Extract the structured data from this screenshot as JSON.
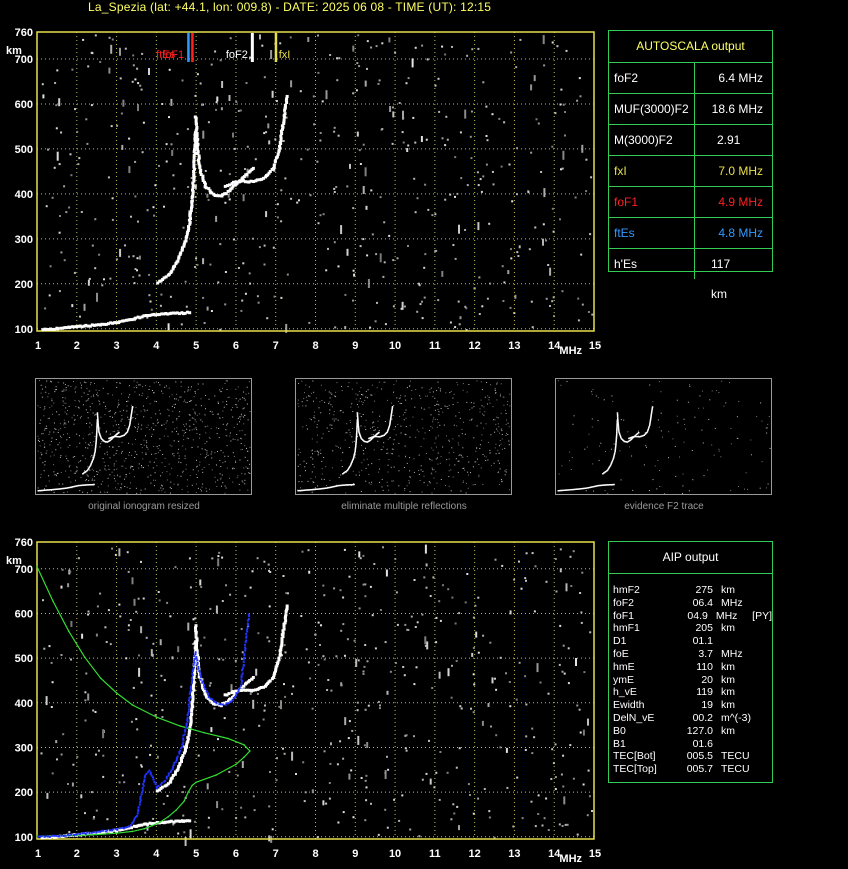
{
  "header": "La_Spezia (lat: +44.1, lon: 009.8) - DATE: 2025 06 08 - TIME (UT): 12:15",
  "colors": {
    "axis": "#e8e04a",
    "grid": "#bfbf40",
    "frame": "#33cc55",
    "trace": "#ffffff",
    "model": "#33dd33",
    "fit": "#2233ff",
    "foF1": "#ff2020",
    "ftEs": "#3399ff",
    "fxI": "#e8e04a"
  },
  "chart_data": [
    {
      "type": "scatter",
      "xlabel": "MHz",
      "ylabel": "km",
      "xlim": [
        1,
        15
      ],
      "ylim": [
        95,
        760
      ],
      "xticks": [
        "1",
        "2",
        "3",
        "4",
        "5",
        "6",
        "7",
        "8",
        "9",
        "10",
        "11",
        "12",
        "13",
        "14",
        "15"
      ],
      "yticks": [
        "100",
        "200",
        "300",
        "400",
        "500",
        "600",
        "700",
        "760"
      ],
      "markers": [
        {
          "label": "ftEs",
          "freq": 4.8
        },
        {
          "label": "foF1",
          "freq": 4.9
        },
        {
          "label": "foF2",
          "freq": 6.4
        },
        {
          "label": "fxI",
          "freq": 7.0
        }
      ],
      "series": [
        {
          "x": [
            1.1,
            1.5,
            2.0,
            2.5,
            3.0,
            3.4,
            3.7,
            4.0,
            4.3,
            4.6,
            4.8
          ],
          "y": [
            101,
            104,
            108,
            112,
            118,
            126,
            132,
            135,
            137,
            138,
            139
          ]
        },
        {
          "x": [
            4.0,
            4.3,
            4.5,
            4.7,
            4.8,
            4.85,
            4.9,
            4.95
          ],
          "y": [
            205,
            225,
            255,
            300,
            340,
            380,
            440,
            540
          ]
        },
        {
          "x": [
            4.95,
            5.0,
            5.05,
            5.2,
            5.4,
            5.6,
            5.8,
            6.0,
            6.2,
            6.4
          ],
          "y": [
            575,
            510,
            460,
            420,
            402,
            398,
            410,
            428,
            445,
            460
          ]
        },
        {
          "x": [
            5.7,
            5.9,
            6.1,
            6.4,
            6.7,
            6.9,
            7.05,
            7.15,
            7.25
          ],
          "y": [
            420,
            428,
            432,
            430,
            440,
            460,
            500,
            560,
            620
          ]
        }
      ]
    },
    {
      "type": "scatter",
      "xlabel": "MHz",
      "ylabel": "km",
      "xlim": [
        1,
        15
      ],
      "ylim": [
        95,
        760
      ],
      "xticks": [
        "1",
        "2",
        "3",
        "4",
        "5",
        "6",
        "7",
        "8",
        "9",
        "10",
        "11",
        "12",
        "13",
        "14",
        "15"
      ],
      "yticks": [
        "100",
        "200",
        "300",
        "400",
        "500",
        "600",
        "700",
        "760"
      ],
      "series": [
        {
          "x": [
            1.1,
            1.5,
            2.0,
            2.5,
            3.0,
            3.4,
            3.7,
            4.0,
            4.3,
            4.6,
            4.8
          ],
          "y": [
            101,
            104,
            108,
            112,
            118,
            126,
            132,
            135,
            137,
            138,
            139
          ]
        },
        {
          "x": [
            4.0,
            4.3,
            4.5,
            4.7,
            4.8,
            4.85,
            4.9,
            4.95
          ],
          "y": [
            205,
            225,
            255,
            300,
            340,
            380,
            440,
            540
          ]
        },
        {
          "x": [
            4.95,
            5.0,
            5.05,
            5.2,
            5.4,
            5.6,
            5.8,
            6.0,
            6.2,
            6.4
          ],
          "y": [
            575,
            510,
            460,
            420,
            402,
            398,
            410,
            428,
            445,
            460
          ]
        },
        {
          "x": [
            5.7,
            5.9,
            6.1,
            6.4,
            6.7,
            6.9,
            7.05,
            7.15,
            7.25
          ],
          "y": [
            420,
            428,
            432,
            430,
            440,
            460,
            500,
            560,
            620
          ]
        },
        {
          "x": [
            1.0,
            1.5,
            2.0,
            2.5,
            3.0,
            3.4,
            3.7,
            3.9,
            4.1,
            4.3,
            4.5,
            4.7,
            4.8,
            4.9,
            5.0,
            5.5,
            6.0,
            6.2,
            6.35,
            6.2,
            5.8,
            5.2,
            4.6,
            4.0,
            3.4,
            3.0,
            2.6,
            2.2,
            1.8,
            1.4,
            1.0
          ],
          "y": [
            101,
            102,
            103,
            105,
            108,
            112,
            118,
            125,
            133,
            145,
            160,
            180,
            200,
            215,
            222,
            238,
            262,
            278,
            292,
            306,
            320,
            333,
            348,
            368,
            395,
            422,
            455,
            502,
            560,
            628,
            705
          ]
        },
        {
          "x": [
            1.0,
            1.5,
            2.0,
            2.5,
            3.0,
            3.3,
            3.5,
            3.7,
            3.8,
            3.9,
            4.0,
            4.2,
            4.4,
            4.6,
            4.75,
            4.85,
            4.95,
            5.1,
            5.3,
            5.5,
            5.7,
            5.9,
            6.1,
            6.3
          ],
          "y": [
            102,
            104,
            108,
            113,
            119,
            125,
            150,
            240,
            250,
            230,
            212,
            228,
            258,
            300,
            360,
            440,
            515,
            455,
            415,
            400,
            398,
            408,
            440,
            600
          ]
        }
      ]
    }
  ],
  "autoscala": {
    "title": "AUTOSCALA output",
    "rows": [
      {
        "label": "foF2",
        "value": "6.4 MHz"
      },
      {
        "label": "MUF(3000)F2",
        "value": "18.6 MHz"
      },
      {
        "label": "M(3000)F2",
        "value": "2.91"
      },
      {
        "label": "fxI",
        "value": "7.0 MHz"
      },
      {
        "label": "foF1",
        "value": "4.9 MHz"
      },
      {
        "label": "ftEs",
        "value": "4.8 MHz"
      },
      {
        "label": "h'Es",
        "value": "117",
        "unit": "km"
      }
    ]
  },
  "aip": {
    "title": "AIP output",
    "rows": [
      {
        "name": "hmF2",
        "value": "275",
        "unit": "km",
        "flag": ""
      },
      {
        "name": "foF2",
        "value": "06.4",
        "unit": "MHz",
        "flag": ""
      },
      {
        "name": "foF1",
        "value": "04.9",
        "unit": "MHz",
        "flag": "[PY]"
      },
      {
        "name": "hmF1",
        "value": "205",
        "unit": "km",
        "flag": ""
      },
      {
        "name": "D1",
        "value": "01.1",
        "unit": "",
        "flag": ""
      },
      {
        "name": "foE",
        "value": "3.7",
        "unit": "MHz",
        "flag": ""
      },
      {
        "name": "hmE",
        "value": "110",
        "unit": "km",
        "flag": ""
      },
      {
        "name": "ymE",
        "value": "20",
        "unit": "km",
        "flag": ""
      },
      {
        "name": "h_vE",
        "value": "119",
        "unit": "km",
        "flag": ""
      },
      {
        "name": "Ewidth",
        "value": "19",
        "unit": "km",
        "flag": ""
      },
      {
        "name": "DelN_vE",
        "value": "00.2",
        "unit": "m^(-3)",
        "flag": ""
      },
      {
        "name": "B0",
        "value": "127.0",
        "unit": "km",
        "flag": ""
      },
      {
        "name": "B1",
        "value": "01.6",
        "unit": "",
        "flag": ""
      },
      {
        "name": "TEC[Bot]",
        "value": "005.5",
        "unit": "TECU",
        "flag": ""
      },
      {
        "name": "TEC[Top]",
        "value": "005.7",
        "unit": "TECU",
        "flag": ""
      }
    ]
  },
  "thumbnails": [
    {
      "caption": "original ionogram resized"
    },
    {
      "caption": "eliminate multiple reflections"
    },
    {
      "caption": "evidence F2 trace"
    }
  ]
}
